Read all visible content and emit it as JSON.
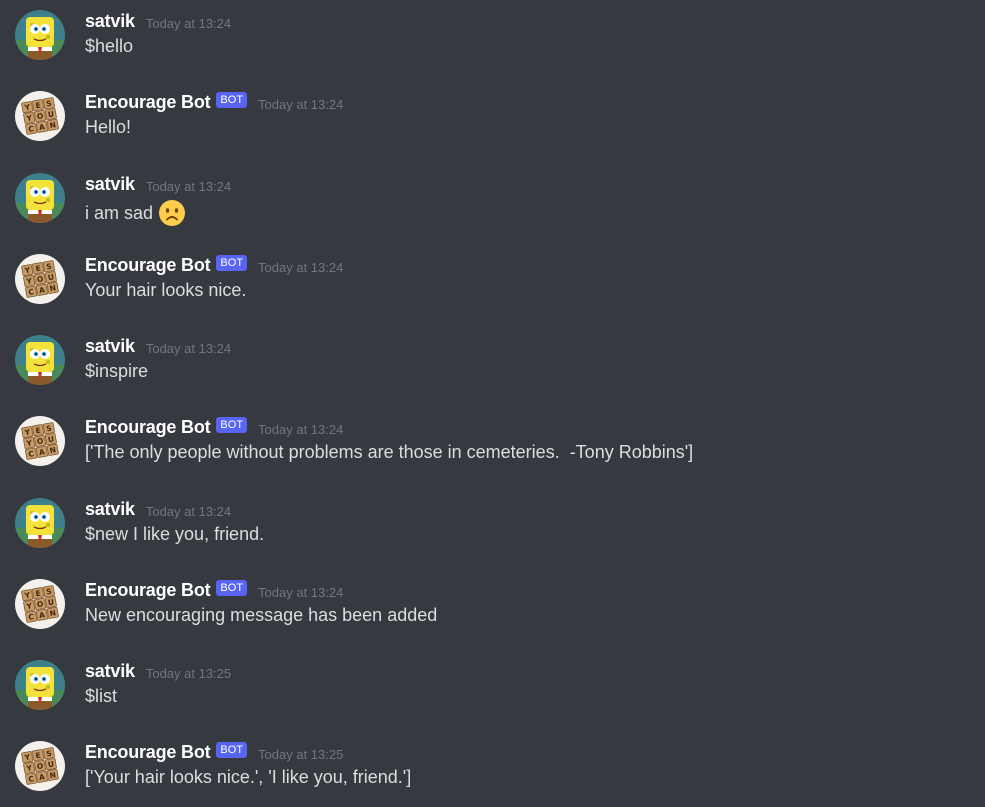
{
  "messages": [
    {
      "author": "satvik",
      "is_bot": false,
      "timestamp": "Today at 13:24",
      "text": "$hello"
    },
    {
      "author": "Encourage Bot",
      "is_bot": true,
      "bot_tag": "BOT",
      "timestamp": "Today at 13:24",
      "text": "Hello!"
    },
    {
      "author": "satvik",
      "is_bot": false,
      "timestamp": "Today at 13:24",
      "text": "i am sad",
      "emoji": "frowning-face-emoji"
    },
    {
      "author": "Encourage Bot",
      "is_bot": true,
      "bot_tag": "BOT",
      "timestamp": "Today at 13:24",
      "text": "Your hair looks nice."
    },
    {
      "author": "satvik",
      "is_bot": false,
      "timestamp": "Today at 13:24",
      "text": "$inspire"
    },
    {
      "author": "Encourage Bot",
      "is_bot": true,
      "bot_tag": "BOT",
      "timestamp": "Today at 13:24",
      "text": "['The only people without problems are those in cemeteries.  -Tony Robbins']"
    },
    {
      "author": "satvik",
      "is_bot": false,
      "timestamp": "Today at 13:24",
      "text": "$new I like you, friend."
    },
    {
      "author": "Encourage Bot",
      "is_bot": true,
      "bot_tag": "BOT",
      "timestamp": "Today at 13:24",
      "text": "New encouraging message has been added"
    },
    {
      "author": "satvik",
      "is_bot": false,
      "timestamp": "Today at 13:25",
      "text": "$list"
    },
    {
      "author": "Encourage Bot",
      "is_bot": true,
      "bot_tag": "BOT",
      "timestamp": "Today at 13:25",
      "text": "['Your hair looks nice.', 'I like you, friend.']"
    }
  ],
  "avatars": {
    "user": "spongebob-avatar",
    "bot": "yes-you-can-tiles-avatar"
  },
  "colors": {
    "background": "#36393f",
    "username": "#ffffff",
    "message_text": "#dcddde",
    "timestamp": "#72767d",
    "bot_tag": "#5865f2"
  }
}
